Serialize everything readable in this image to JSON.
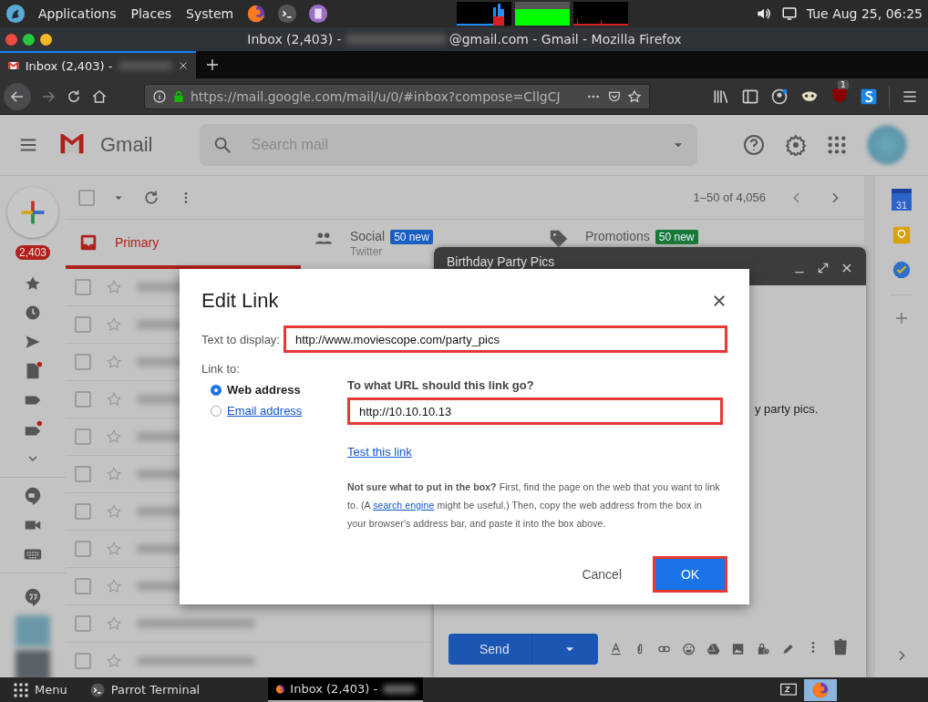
{
  "desktop_panel": {
    "menus": [
      "Applications",
      "Places",
      "System"
    ],
    "clock": "Tue Aug 25, 06:25"
  },
  "window": {
    "title_start": "Inbox (2,403) -",
    "title_end": "@gmail.com - Gmail - Mozilla Firefox"
  },
  "browser_tabs": [
    {
      "label": "Inbox (2,403) -",
      "selected": true
    }
  ],
  "address_bar": {
    "url": "https://mail.google.com/mail/u/0/#inbox?compose=CllgCJ"
  },
  "addon_badge": "1",
  "gmail": {
    "logo_text": "Gmail",
    "search": {
      "placeholder": "Search mail"
    },
    "unread_badge": "2,403",
    "pagination": "1–50 of 4,056",
    "category_tabs": [
      {
        "label": "Primary",
        "selected": true
      },
      {
        "label": "Social",
        "badge": "50 new",
        "color": "#1a5fc0",
        "subtitle": "Twitter",
        "selected": false
      },
      {
        "label": "Promotions",
        "badge": "50 new",
        "color": "#177837",
        "selected": false
      }
    ],
    "calendar_day": "31",
    "select_all_checked": false,
    "rows": [
      {
        "checked": false,
        "starred": false
      },
      {
        "checked": false,
        "starred": false
      },
      {
        "checked": false,
        "starred": false
      },
      {
        "checked": false,
        "starred": false
      },
      {
        "checked": false,
        "starred": false
      },
      {
        "checked": false,
        "starred": false
      },
      {
        "checked": false,
        "starred": false
      },
      {
        "checked": false,
        "starred": false
      },
      {
        "checked": false,
        "starred": false
      },
      {
        "checked": false,
        "starred": false
      },
      {
        "checked": false,
        "starred": false
      }
    ]
  },
  "compose": {
    "subject": "Birthday Party Pics",
    "body_fragment": "y party pics.",
    "send": "Send"
  },
  "dialog": {
    "title": "Edit Link",
    "display_label": "Text to display:",
    "display_value": "http://www.moviescope.com/party_pics",
    "display_highlighted": true,
    "link_to_label": "Link to:",
    "link_types": [
      {
        "label": "Web address",
        "selected": true
      },
      {
        "label": "Email address",
        "selected": false
      }
    ],
    "url_prompt": "To what URL should this link go?",
    "url_value": "http://10.10.10.13",
    "url_highlighted": true,
    "test_link": "Test this link",
    "help_start": "**Not sure what to put in the box?** First, find the page on the web that you want to link to. (A ",
    "help_link": "search engine",
    "help_end": " might be useful.) Then, copy the web address from the box in your browser's address bar, and paste it into the box above.",
    "buttons": [
      {
        "label": "Cancel",
        "kind": "secondary",
        "highlighted": false
      },
      {
        "label": "OK",
        "kind": "primary",
        "highlighted": true
      }
    ]
  },
  "taskbar": {
    "menu": "Menu",
    "items": [
      {
        "label": "Parrot Terminal",
        "selected": false
      },
      {
        "label": "Inbox (2,403) -",
        "selected": true
      }
    ]
  }
}
